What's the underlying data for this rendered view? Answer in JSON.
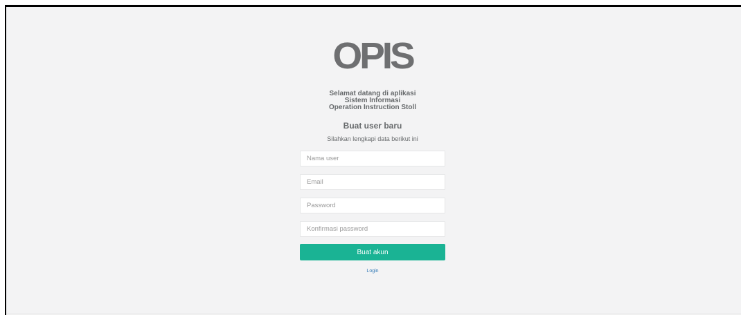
{
  "brand": {
    "logo_text": "OPIS"
  },
  "welcome": {
    "line1": "Selamat datang di aplikasi",
    "line2": "Sistem Informasi",
    "line3": "Operation Instruction Stoll"
  },
  "form": {
    "heading": "Buat user baru",
    "subtitle": "Silahkan lengkapi data berikut ini",
    "username_placeholder": "Nama user",
    "email_placeholder": "Email",
    "password_placeholder": "Password",
    "confirm_password_placeholder": "Konfirmasi password",
    "submit_label": "Buat akun",
    "login_link_label": "Login"
  },
  "colors": {
    "background": "#f3f3f4",
    "primary_button": "#1ab394",
    "link": "#337ab7",
    "logo": "#6e6f71"
  }
}
